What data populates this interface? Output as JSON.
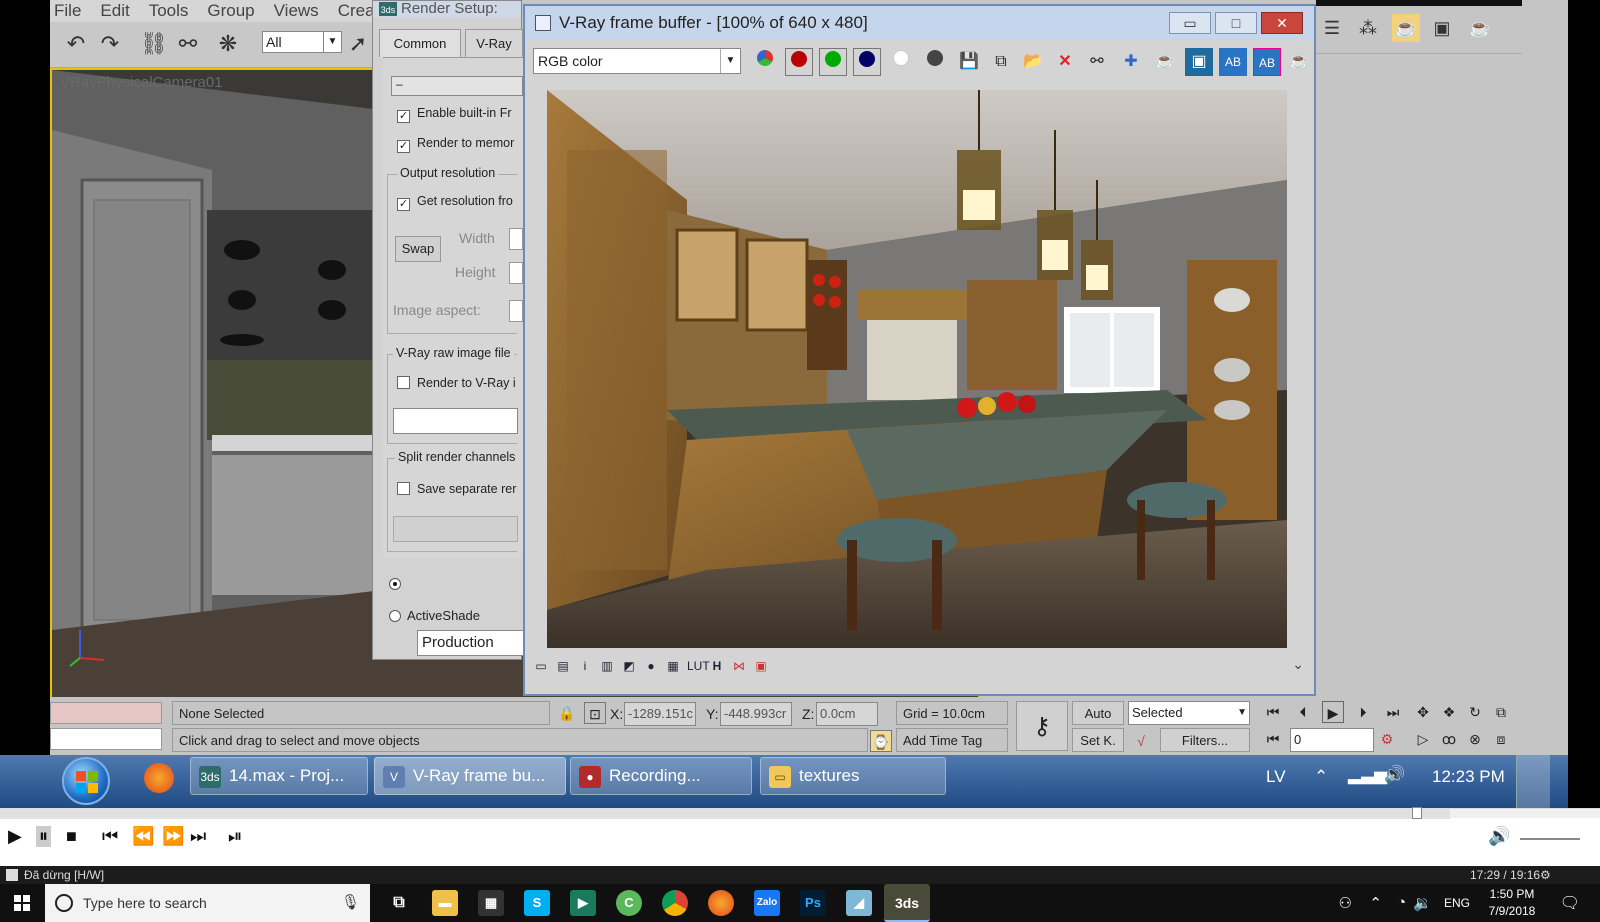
{
  "max": {
    "menu": [
      "File",
      "Edit",
      "Tools",
      "Group",
      "Views",
      "Creat"
    ],
    "selection_filter": "All",
    "viewport_label": "VRayPhysicalCamera01"
  },
  "render_setup": {
    "title": "Render Setup:",
    "tabs": [
      "Common",
      "V-Ray"
    ],
    "enable_builtin": "Enable built-in Fr",
    "render_to_memory": "Render to memor",
    "output_resolution": "Output resolution",
    "get_resolution": "Get resolution fro",
    "swap": "Swap",
    "width": "Width",
    "height": "Height",
    "image_aspect": "Image aspect:",
    "raw_group": "V-Ray raw image file",
    "render_to_vray": "Render to V-Ray i",
    "split_group": "Split render channels",
    "save_separate": "Save separate rer",
    "production": "Production",
    "activeshade": "ActiveShade"
  },
  "vfb": {
    "title": "V-Ray frame buffer - [100% of 640 x 480]",
    "channel": "RGB color",
    "minimize": "▭",
    "maximize": "□",
    "close": "✕"
  },
  "status": {
    "selection": "None Selected",
    "prompt": "Click and drag to select and move objects",
    "x_label": "X:",
    "x_value": "-1289.151c",
    "y_label": "Y:",
    "y_value": "-448.993cr",
    "z_label": "Z:",
    "z_value": "0.0cm",
    "grid": "Grid = 10.0cm",
    "add_time_tag": "Add Time Tag",
    "auto": "Auto",
    "set_k": "Set K.",
    "selected": "Selected",
    "filters": "Filters...",
    "frame": "0"
  },
  "taskbar7": {
    "items": [
      "14.max    - Proj...",
      "V-Ray frame bu...",
      "Recording...",
      "textures"
    ],
    "lang": "LV",
    "time": "12:23 PM"
  },
  "player": {
    "status": "Đã dừng [H/W]",
    "position": "17:29 / 19:16",
    "progress": 0.906
  },
  "taskbar10": {
    "search_placeholder": "Type here to search",
    "lang": "ENG",
    "time": "1:50 PM",
    "date": "7/9/2018"
  }
}
